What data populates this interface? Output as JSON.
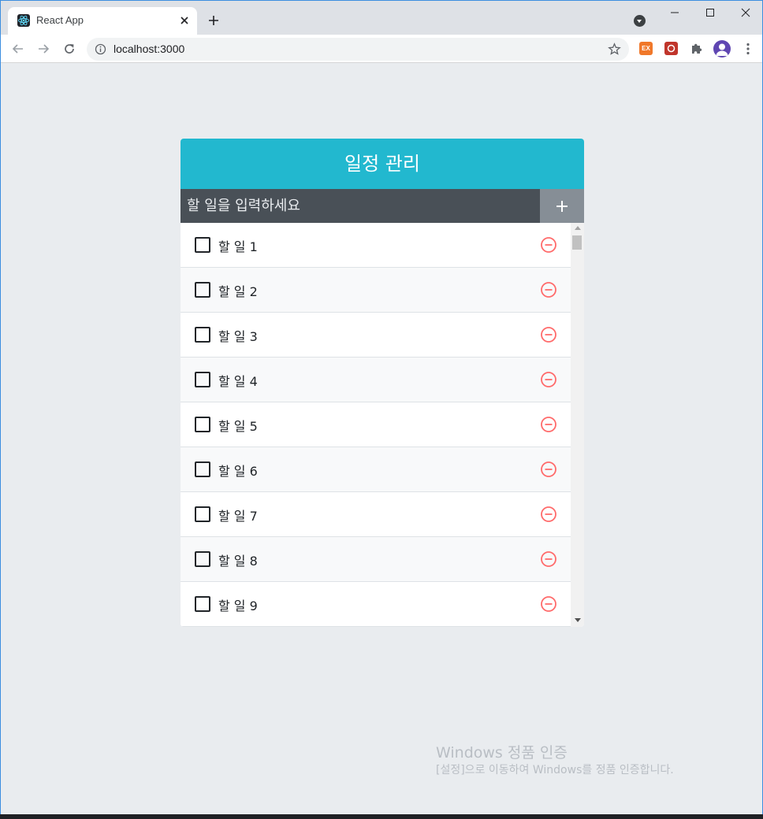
{
  "browser": {
    "tab_title": "React App",
    "url": "localhost:3000"
  },
  "extensions": {
    "ex_label": "EX"
  },
  "app": {
    "title": "일정 관리",
    "input_placeholder": "할 일을 입력하세요",
    "todos": [
      {
        "text": "할 일 1",
        "checked": false
      },
      {
        "text": "할 일 2",
        "checked": false
      },
      {
        "text": "할 일 3",
        "checked": false
      },
      {
        "text": "할 일 4",
        "checked": false
      },
      {
        "text": "할 일 5",
        "checked": false
      },
      {
        "text": "할 일 6",
        "checked": false
      },
      {
        "text": "할 일 7",
        "checked": false
      },
      {
        "text": "할 일 8",
        "checked": false
      },
      {
        "text": "할 일 9",
        "checked": false
      }
    ]
  },
  "colors": {
    "title_bg": "#22b8cf",
    "input_bg": "#495057",
    "button_bg": "#868e96",
    "remove": "#ff6b6b",
    "page_bg": "#e9ecef"
  },
  "watermark": {
    "title": "Windows 정품 인증",
    "subtitle": "[설정]으로 이동하여 Windows를 정품 인증합니다."
  }
}
